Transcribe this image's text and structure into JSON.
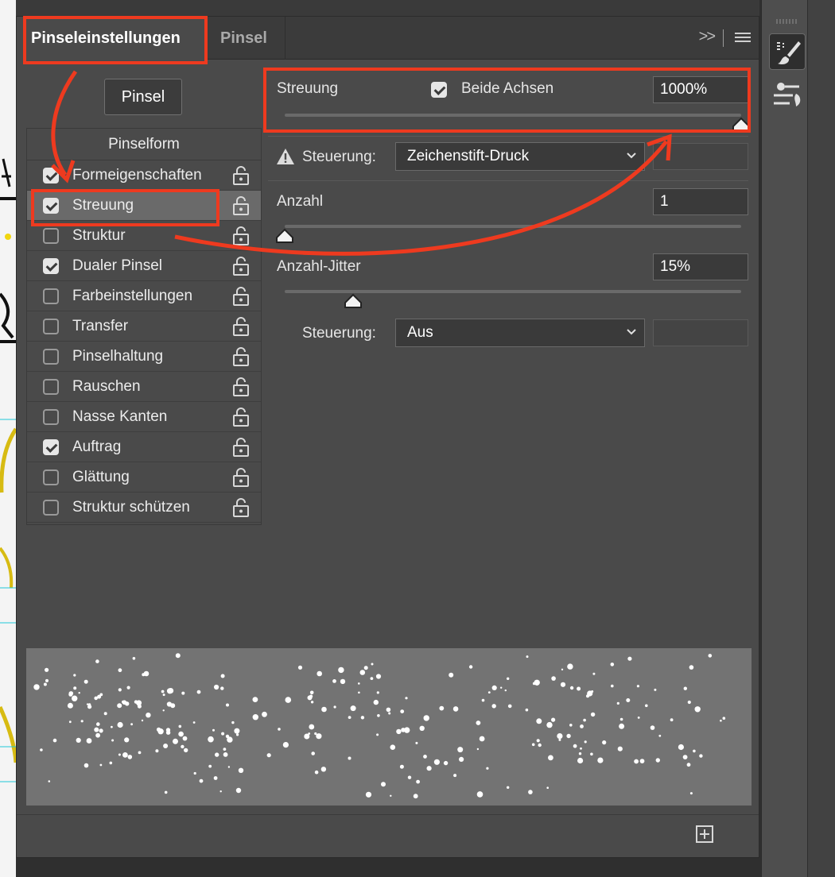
{
  "header": {
    "tabs": [
      {
        "label": "Pinseleinstellungen",
        "active": true
      },
      {
        "label": "Pinsel",
        "active": false
      }
    ],
    "collapse_glyph": ">>"
  },
  "brushes_button": {
    "label": "Pinsel"
  },
  "categories": {
    "header": "Pinselform",
    "items": [
      {
        "label": "Formeigenschaften",
        "checked": true
      },
      {
        "label": "Streuung",
        "checked": true,
        "selected": true
      },
      {
        "label": "Struktur",
        "checked": false
      },
      {
        "label": "Dualer Pinsel",
        "checked": true
      },
      {
        "label": "Farbeinstellungen",
        "checked": false
      },
      {
        "label": "Transfer",
        "checked": false
      },
      {
        "label": "Pinselhaltung",
        "checked": false
      },
      {
        "label": "Rauschen",
        "checked": false
      },
      {
        "label": "Nasse Kanten",
        "checked": false
      },
      {
        "label": "Auftrag",
        "checked": true
      },
      {
        "label": "Glättung",
        "checked": false
      },
      {
        "label": "Struktur schützen",
        "checked": false
      }
    ]
  },
  "scatter": {
    "label": "Streuung",
    "both_axes_label": "Beide Achsen",
    "both_axes_checked": true,
    "value": "1000%",
    "slider_fraction": 1.0
  },
  "control1": {
    "label": "Steuerung:",
    "value": "Zeichenstift-Druck",
    "warning": true
  },
  "count": {
    "label": "Anzahl",
    "value": "1",
    "slider_fraction": 0.0
  },
  "count_jitter": {
    "label": "Anzahl-Jitter",
    "value": "15%",
    "slider_fraction": 0.15
  },
  "control2": {
    "label": "Steuerung:",
    "value": "Aus"
  },
  "colors": {
    "annotation": "#ee3a1f",
    "panel": "#4a4a4a",
    "preview_bg": "#737373"
  }
}
